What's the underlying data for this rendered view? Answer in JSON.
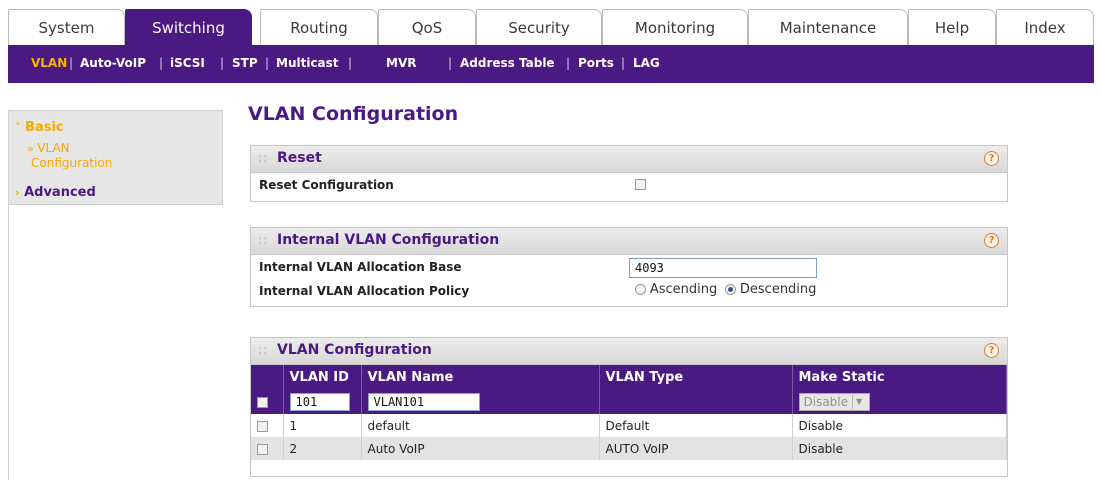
{
  "top_tabs": [
    {
      "label": "System",
      "active": false
    },
    {
      "label": "Switching",
      "active": true
    },
    {
      "label": "Routing",
      "active": false
    },
    {
      "label": "QoS",
      "active": false
    },
    {
      "label": "Security",
      "active": false
    },
    {
      "label": "Monitoring",
      "active": false
    },
    {
      "label": "Maintenance",
      "active": false
    },
    {
      "label": "Help",
      "active": false
    },
    {
      "label": "Index",
      "active": false
    }
  ],
  "submenu": [
    {
      "label": "VLAN",
      "active": true
    },
    {
      "label": "Auto-VoIP",
      "active": false
    },
    {
      "label": "iSCSI",
      "active": false
    },
    {
      "label": "STP",
      "active": false
    },
    {
      "label": "Multicast",
      "active": false
    },
    {
      "label": "MVR",
      "active": false
    },
    {
      "label": "Address Table",
      "active": false
    },
    {
      "label": "Ports",
      "active": false
    },
    {
      "label": "LAG",
      "active": false
    }
  ],
  "leftnav": {
    "basic": "Basic",
    "vlan_config_line1": "VLAN",
    "vlan_config_line2": "Configuration",
    "advanced": "Advanced"
  },
  "page_title": "VLAN Configuration",
  "reset_panel": {
    "title": "Reset",
    "help": "?",
    "reset_label": "Reset Configuration",
    "reset_checked": false
  },
  "internal_panel": {
    "title": "Internal VLAN Configuration",
    "help": "?",
    "base_label": "Internal VLAN Allocation Base",
    "base_value": "4093",
    "policy_label": "Internal VLAN Allocation Policy",
    "ascending": "Ascending",
    "descending": "Descending",
    "selected": "Descending"
  },
  "vlan_panel": {
    "title": "VLAN Configuration",
    "help": "?",
    "columns": [
      "VLAN ID",
      "VLAN Name",
      "VLAN Type",
      "Make Static"
    ],
    "edit_row": {
      "vlan_id": "101",
      "vlan_name": "VLAN101",
      "vlan_type": "",
      "make_static": "Disable"
    },
    "rows": [
      {
        "vlan_id": "1",
        "vlan_name": "default",
        "vlan_type": "Default",
        "make_static": "Disable"
      },
      {
        "vlan_id": "2",
        "vlan_name": "Auto VoIP",
        "vlan_type": "AUTO VoIP",
        "make_static": "Disable"
      }
    ]
  },
  "colors": {
    "brand_purple": "#4a1981",
    "active_orange": "#f5a800",
    "help_orange": "#e07a2a"
  }
}
